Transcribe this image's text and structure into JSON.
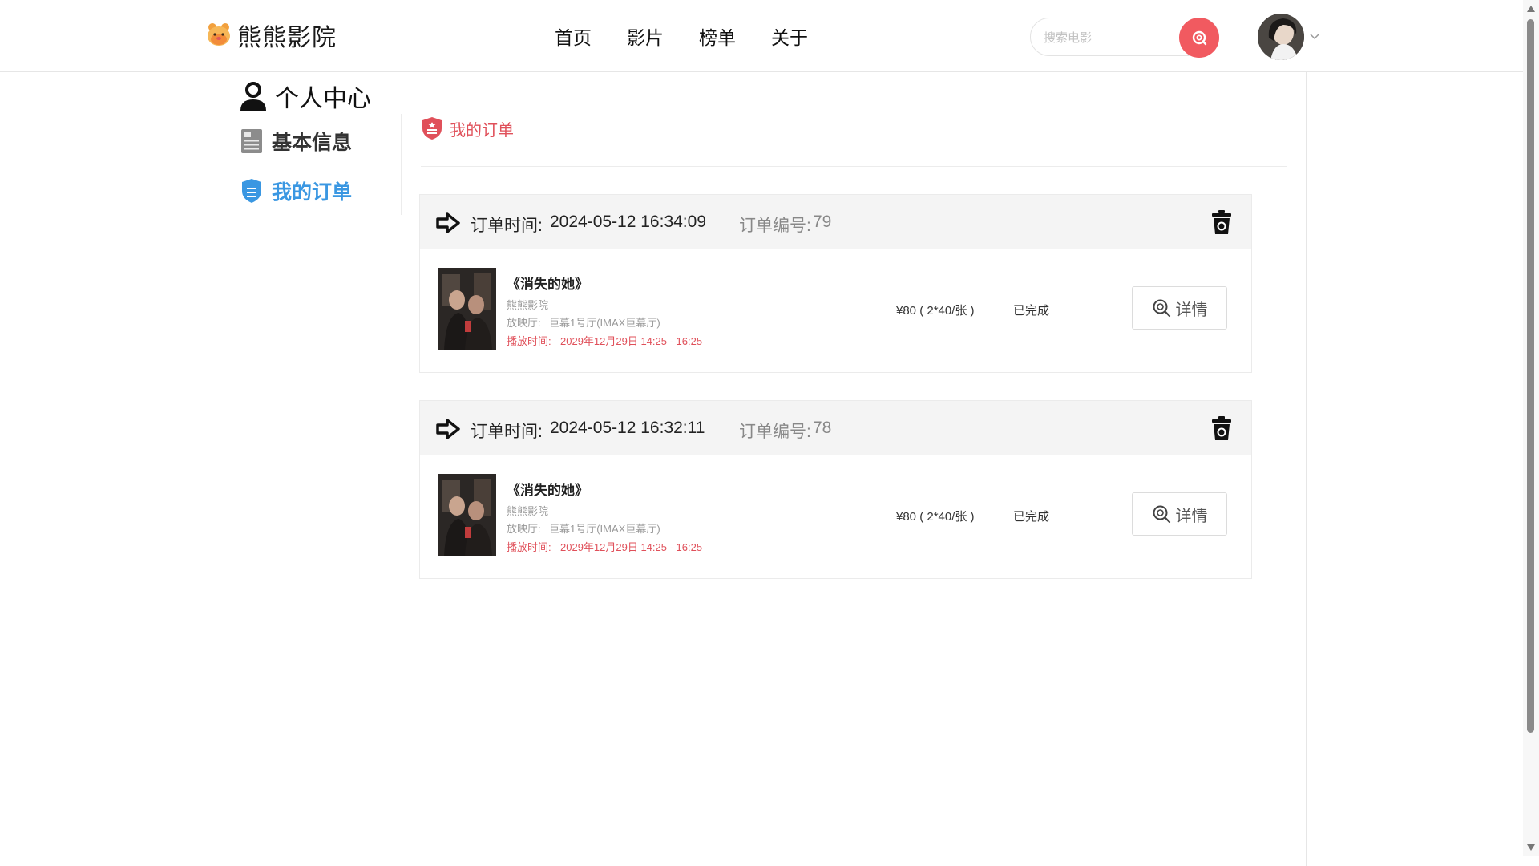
{
  "header": {
    "brand": "熊熊影院",
    "nav": [
      "首页",
      "影片",
      "榜单",
      "关于"
    ],
    "search_placeholder": "搜索电影"
  },
  "sidebar": {
    "title": "个人中心",
    "items": [
      {
        "label": "基本信息",
        "active": false
      },
      {
        "label": "我的订单",
        "active": true
      }
    ]
  },
  "content": {
    "heading": "我的订单"
  },
  "orders": [
    {
      "time_label": "订单时间:",
      "time": "2024-05-12 16:34:09",
      "no_label": "订单编号:",
      "no": "79",
      "movie": "《消失的她》",
      "cinema": "熊熊影院",
      "hall_label": "放映厅:",
      "hall": "巨幕1号厅(IMAX巨幕厅)",
      "play_label": "播放时间:",
      "play_time": "2029年12月29日 14:25 - 16:25",
      "price": "¥80 ( 2*40/张 )",
      "status": "已完成",
      "detail_label": "详情"
    },
    {
      "time_label": "订单时间:",
      "time": "2024-05-12 16:32:11",
      "no_label": "订单编号:",
      "no": "78",
      "movie": "《消失的她》",
      "cinema": "熊熊影院",
      "hall_label": "放映厅:",
      "hall": "巨幕1号厅(IMAX巨幕厅)",
      "play_label": "播放时间:",
      "play_time": "2029年12月29日 14:25 - 16:25",
      "price": "¥80 ( 2*40/张 )",
      "status": "已完成",
      "detail_label": "详情"
    }
  ],
  "colors": {
    "accent_red": "#e0505a",
    "search_button": "#f15a60",
    "active_blue": "#3a97e2",
    "order_header_bg": "#f4f4f4"
  },
  "icons": {
    "logo": "bear-logo-icon",
    "search": "search-icon",
    "caret": "chevron-down-icon",
    "profile": "user-icon",
    "basic_info": "document-icon",
    "orders": "shield-icon",
    "order_arrow": "arrow-right-icon",
    "delete": "trash-icon",
    "detail": "magnifier-icon"
  }
}
